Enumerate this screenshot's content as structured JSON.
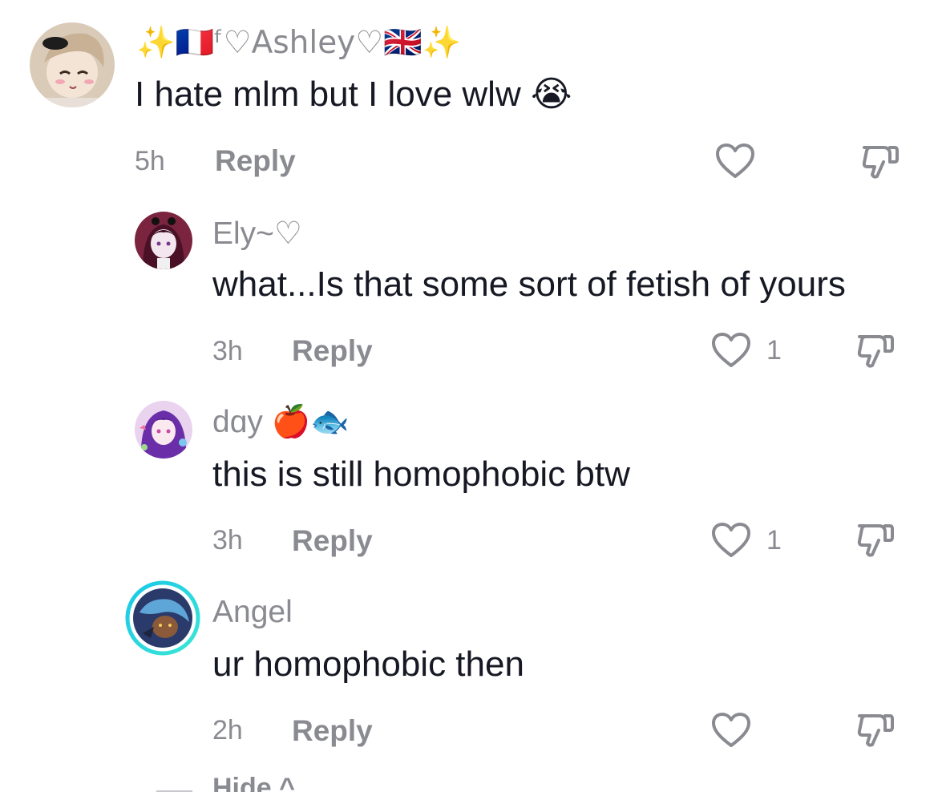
{
  "comments": [
    {
      "username": "✨🇫🇷ᶠ♡Ashley♡🇬🇧✨",
      "text": "I hate mlm but I love wlw 😭",
      "time": "5h",
      "reply": "Reply",
      "likes": "",
      "avatar": "gacha-girl-avatar"
    },
    {
      "username": "Ely~♡",
      "text": "what...Is that some sort of fetish of yours",
      "time": "3h",
      "reply": "Reply",
      "likes": "1",
      "avatar": "dark-hair-girl-avatar"
    },
    {
      "username": "dɑy 🍎🐟",
      "text": "this is still homophobic btw",
      "time": "3h",
      "reply": "Reply",
      "likes": "1",
      "avatar": "purple-hair-avatar"
    },
    {
      "username": "Angel",
      "text": "ur homophobic then",
      "time": "2h",
      "reply": "Reply",
      "likes": "",
      "avatar": "blue-ring-avatar"
    }
  ],
  "hide": {
    "label": "Hide ^"
  },
  "colors": {
    "text": "#161823",
    "muted": "#8a8b91",
    "story_ring": "#20d5ec"
  }
}
